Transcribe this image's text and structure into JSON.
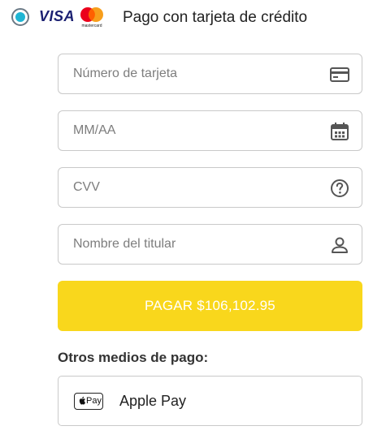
{
  "header": {
    "title": "Pago con tarjeta de crédito",
    "visa_label": "VISA",
    "mastercard_label": "mastercard",
    "radio_selected": true,
    "radio_color": "#1fb5d4"
  },
  "fields": {
    "card_number": {
      "placeholder": "Número de tarjeta",
      "icon": "credit-card-icon"
    },
    "expiry": {
      "placeholder": "MM/AA",
      "icon": "calendar-icon"
    },
    "cvv": {
      "placeholder": "CVV",
      "icon": "help-circle-icon"
    },
    "holder": {
      "placeholder": "Nombre del titular",
      "icon": "user-icon"
    }
  },
  "pay_button": {
    "label": "PAGAR $106,102.95",
    "color": "#f9d71c"
  },
  "other_methods": {
    "heading": "Otros medios de pago:",
    "apple_pay": {
      "badge": "Pay",
      "label": "Apple Pay",
      "icon": "apple-pay-icon"
    }
  }
}
